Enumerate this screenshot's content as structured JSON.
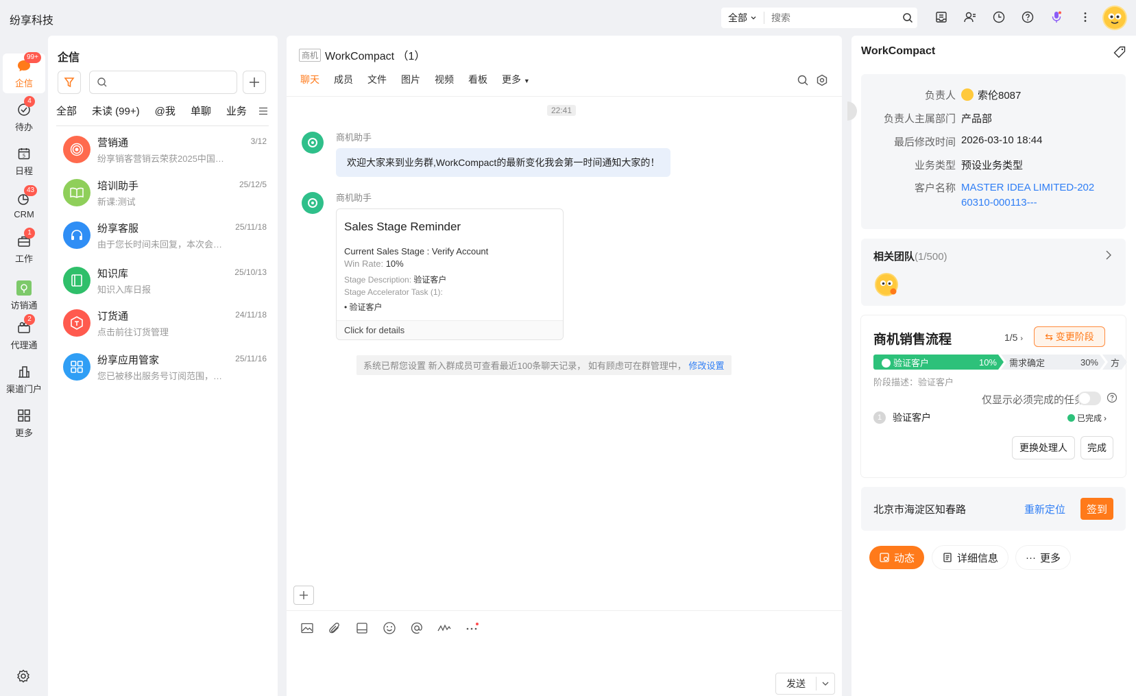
{
  "app": {
    "brand": "纷享科技"
  },
  "search": {
    "scope": "全部",
    "placeholder": "搜索"
  },
  "nav": {
    "items": [
      {
        "label": "企信",
        "badge": "99+"
      },
      {
        "label": "待办",
        "badge": "4"
      },
      {
        "label": "日程",
        "badge": ""
      },
      {
        "label": "CRM",
        "badge": "43"
      },
      {
        "label": "工作",
        "badge": "1"
      },
      {
        "label": "访销通",
        "badge": ""
      },
      {
        "label": "代理通",
        "badge": "2"
      },
      {
        "label": "渠道门户",
        "badge": ""
      },
      {
        "label": "更多",
        "badge": ""
      }
    ]
  },
  "convlist": {
    "title": "企信",
    "tabs": [
      "全部",
      "未读 (99+)",
      "@我",
      "单聊",
      "业务"
    ],
    "items": [
      {
        "name": "营销通",
        "preview": "纷享销客营销云荣获2025中国数字化营销...",
        "date": "3/12",
        "color": "#ff6a4d"
      },
      {
        "name": "培训助手",
        "preview": "新课:测试",
        "date": "25/12/5",
        "color": "#8fcf5a"
      },
      {
        "name": "纷享客服",
        "preview": "由于您长时间未回复，本次会话已结束",
        "date": "25/11/18",
        "color": "#2f8ef5"
      },
      {
        "name": "知识库",
        "preview": "知识入库日报",
        "date": "25/10/13",
        "color": "#2fbf6a"
      },
      {
        "name": "订货通",
        "preview": "点击前往订货管理",
        "date": "24/11/18",
        "color": "#ff5a4e"
      },
      {
        "name": "纷享应用管家",
        "preview": "您已被移出服务号订阅范围，无法继续使用",
        "date": "25/11/16",
        "color": "#2f9ef5"
      }
    ]
  },
  "chat": {
    "tag": "商机",
    "title": "WorkCompact （1）",
    "tabs": [
      "聊天",
      "成员",
      "文件",
      "图片",
      "视频",
      "看板",
      "更多"
    ],
    "time": "22:41",
    "sender": "商机助手",
    "welcome": "欢迎大家来到业务群,WorkCompact的最新变化我会第一时间通知大家的！",
    "card": {
      "title": "Sales Stage Reminder",
      "stage": "Current Sales Stage : Verify Account",
      "win_label": "Win Rate: ",
      "win_value": "10%",
      "desc_label": "Stage Description: ",
      "desc_value": "验证客户",
      "task_label": "Stage Accelerator Task (1):",
      "task_item": "• 验证客户",
      "footer": "Click for details"
    },
    "sys_note": "系统已帮您设置 新入群成员可查看最近100条聊天记录， 如有顾虑可在群管理中，",
    "sys_link": "修改设置",
    "send": "发送"
  },
  "detail": {
    "title": "WorkCompact",
    "info": [
      {
        "key": "负责人",
        "value": "索伦8087"
      },
      {
        "key": "负责人主属部门",
        "value": "产品部"
      },
      {
        "key": "最后修改时间",
        "value": "2026-03-10 18:44"
      },
      {
        "key": "业务类型",
        "value": "预设业务类型"
      },
      {
        "key": "客户名称",
        "value": "MASTER IDEA LIMITED-20260310-000113---"
      }
    ],
    "team_title": "相关团队",
    "team_count": "(1/500)",
    "process": {
      "title": "商机销售流程",
      "step": "1/5",
      "change": "⇆ 变更阶段",
      "stages": [
        {
          "name": "验证客户",
          "pct": "10%"
        },
        {
          "name": "需求确定",
          "pct": "30%"
        },
        {
          "name": "方",
          "pct": ""
        }
      ],
      "desc": "阶段描述：验证客户",
      "only_required": "仅显示必须完成的任务",
      "task_num": "1",
      "task_name": "验证客户",
      "task_status": "已完成",
      "reassign": "更换处理人",
      "complete": "完成"
    },
    "location": "北京市海淀区知春路",
    "relocate": "重新定位",
    "checkin": "签到",
    "tabs": [
      "动态",
      "详细信息",
      "更多"
    ]
  },
  "colors": {
    "accent": "#ff7a1a",
    "link": "#2f7ef5",
    "stage_active": "#2dc17a"
  }
}
